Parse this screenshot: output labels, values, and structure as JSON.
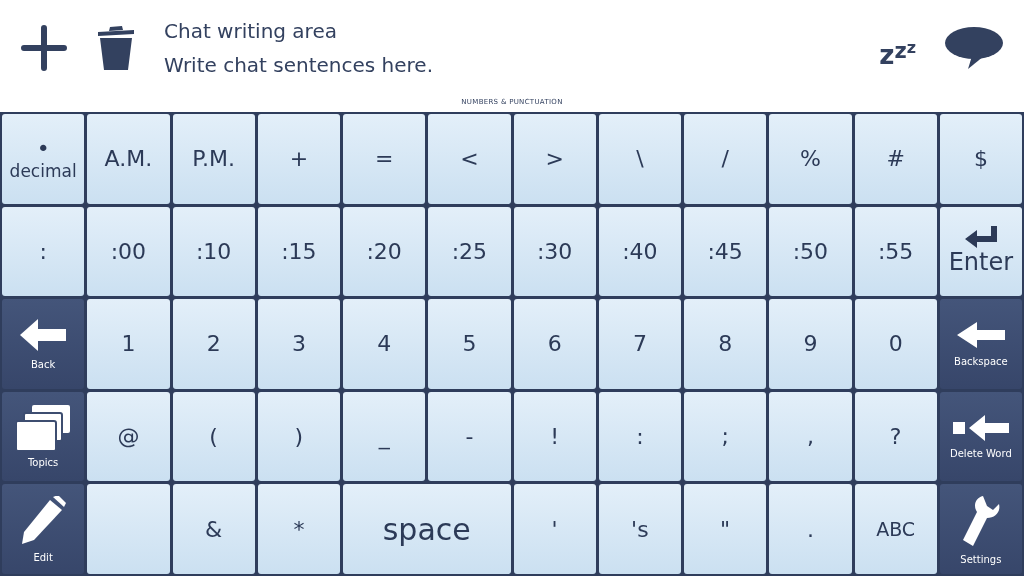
{
  "toolbar": {
    "chat_title": "Chat writing area",
    "chat_hint": "Write chat sentences here.",
    "sleep": "zzz"
  },
  "keyboard": {
    "title": "NUMBERS & PUNCTUATION",
    "keys": [
      {
        "kind": "sym",
        "label": "•",
        "sub": "decimal"
      },
      {
        "kind": "sym",
        "label": "A.M."
      },
      {
        "kind": "sym",
        "label": "P.M."
      },
      {
        "kind": "sym",
        "label": "+"
      },
      {
        "kind": "sym",
        "label": "="
      },
      {
        "kind": "sym",
        "label": "<"
      },
      {
        "kind": "sym",
        "label": ">"
      },
      {
        "kind": "sym",
        "label": "\\"
      },
      {
        "kind": "sym",
        "label": "/"
      },
      {
        "kind": "sym",
        "label": "%"
      },
      {
        "kind": "sym",
        "label": "#"
      },
      {
        "kind": "sym",
        "label": "$"
      },
      {
        "kind": "sym",
        "label": ":"
      },
      {
        "kind": "sym",
        "label": ":00"
      },
      {
        "kind": "sym",
        "label": ":10"
      },
      {
        "kind": "sym",
        "label": ":15"
      },
      {
        "kind": "sym",
        "label": ":20"
      },
      {
        "kind": "sym",
        "label": ":25"
      },
      {
        "kind": "sym",
        "label": ":30"
      },
      {
        "kind": "sym",
        "label": ":40"
      },
      {
        "kind": "sym",
        "label": ":45"
      },
      {
        "kind": "sym",
        "label": ":50"
      },
      {
        "kind": "sym",
        "label": ":55"
      },
      {
        "kind": "enter",
        "label": "Enter"
      },
      {
        "kind": "back",
        "label": "Back"
      },
      {
        "kind": "sym",
        "label": "1"
      },
      {
        "kind": "sym",
        "label": "2"
      },
      {
        "kind": "sym",
        "label": "3"
      },
      {
        "kind": "sym",
        "label": "4"
      },
      {
        "kind": "sym",
        "label": "5"
      },
      {
        "kind": "sym",
        "label": "6"
      },
      {
        "kind": "sym",
        "label": "7"
      },
      {
        "kind": "sym",
        "label": "8"
      },
      {
        "kind": "sym",
        "label": "9"
      },
      {
        "kind": "sym",
        "label": "0"
      },
      {
        "kind": "backspace",
        "label": "Backspace"
      },
      {
        "kind": "topics",
        "label": "Topics"
      },
      {
        "kind": "sym",
        "label": "@"
      },
      {
        "kind": "sym",
        "label": "("
      },
      {
        "kind": "sym",
        "label": ")"
      },
      {
        "kind": "sym",
        "label": "_"
      },
      {
        "kind": "sym",
        "label": "-"
      },
      {
        "kind": "sym",
        "label": "!"
      },
      {
        "kind": "sym",
        "label": ":"
      },
      {
        "kind": "sym",
        "label": ";"
      },
      {
        "kind": "sym",
        "label": ","
      },
      {
        "kind": "sym",
        "label": "?"
      },
      {
        "kind": "delete-word",
        "label": "Delete Word"
      },
      {
        "kind": "edit",
        "label": "Edit"
      },
      {
        "kind": "blank"
      },
      {
        "kind": "sym",
        "label": "&"
      },
      {
        "kind": "sym",
        "label": "*"
      },
      {
        "kind": "wide",
        "label": "space"
      },
      {
        "kind": "sym",
        "label": "'"
      },
      {
        "kind": "sym",
        "label": "'s"
      },
      {
        "kind": "sym",
        "label": "\""
      },
      {
        "kind": "sym",
        "label": "."
      },
      {
        "kind": "small",
        "label": "ABC"
      },
      {
        "kind": "settings",
        "label": "Settings"
      }
    ]
  }
}
